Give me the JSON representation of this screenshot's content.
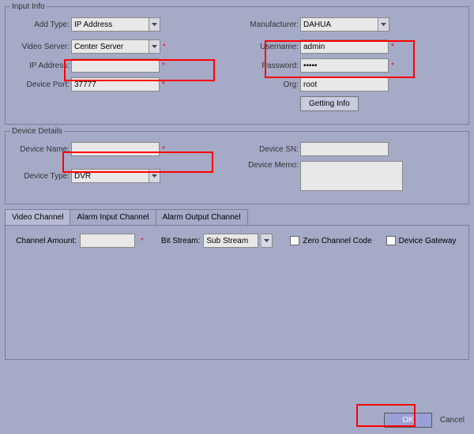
{
  "input_info": {
    "legend": "Input Info",
    "add_type": {
      "label": "Add Type:",
      "value": "IP Address"
    },
    "manufacturer": {
      "label": "Manufacturer:",
      "value": "DAHUA"
    },
    "video_server": {
      "label": "Video Server:",
      "value": "Center Server"
    },
    "username": {
      "label": "Username:",
      "value": "admin"
    },
    "ip_address": {
      "label": "IP Address:",
      "value": ""
    },
    "password": {
      "label": "Password:",
      "value": "•••••"
    },
    "device_port": {
      "label": "Device Port:",
      "value": "37777"
    },
    "org": {
      "label": "Org:",
      "value": "root"
    },
    "getting_info": "Getting Info"
  },
  "device_details": {
    "legend": "Device Details",
    "device_name": {
      "label": "Device Name:",
      "value": ""
    },
    "device_sn": {
      "label": "Device SN:",
      "value": ""
    },
    "device_type": {
      "label": "Device Type:",
      "value": "DVR"
    },
    "device_memo": {
      "label": "Device Memo:",
      "value": ""
    }
  },
  "tabs": {
    "video": "Video Channel",
    "alarm_in": "Alarm Input Channel",
    "alarm_out": "Alarm Output Channel"
  },
  "video_channel": {
    "channel_amount": {
      "label": "Channel Amount:",
      "value": ""
    },
    "bit_stream": {
      "label": "Bit Stream:",
      "value": "Sub Stream"
    },
    "zero_channel": "Zero Channel Code",
    "device_gateway": "Device Gateway"
  },
  "buttons": {
    "ok": "OK",
    "cancel": "Cancel"
  },
  "required": "*"
}
